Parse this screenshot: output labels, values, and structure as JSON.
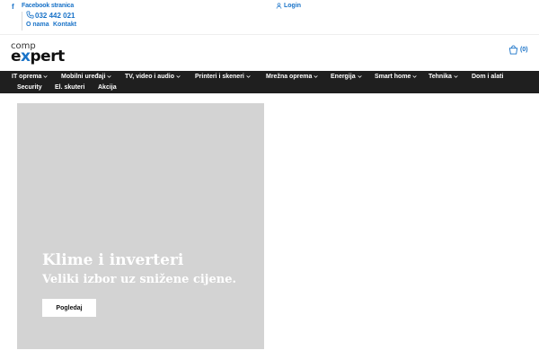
{
  "topbar": {
    "facebook_icon": "facebook-icon",
    "facebook_text": "Facebook stranica",
    "phone_icon": "phone-icon",
    "phone": "032 442 021",
    "about_label": "O nama",
    "contact_label": "Kontakt",
    "login_icon": "user-icon",
    "login_label": "Login"
  },
  "logo": {
    "line1": "comp",
    "line2_part1": "e",
    "line2_part2": "x",
    "line2_part3": "pert"
  },
  "cart": {
    "icon": "shopping-bag-icon",
    "count": "(0)"
  },
  "nav": {
    "items": [
      {
        "label": "IT oprema"
      },
      {
        "label": "Mobilni uređaji"
      },
      {
        "label": "TV, video i audio"
      },
      {
        "label": "Printeri i skeneri"
      },
      {
        "label": "Mrežna oprema"
      },
      {
        "label": "Energija"
      },
      {
        "label": "Smart home"
      },
      {
        "label": "Tehnika"
      },
      {
        "label": "Dom i alati"
      },
      {
        "label": "Security"
      },
      {
        "label": "El. skuteri"
      },
      {
        "label": "Akcija"
      }
    ]
  },
  "hero": {
    "title": "Klime i inverteri",
    "subtitle": "Veliki izbor uz snižene cijene.",
    "button_label": "Pogledaj"
  },
  "colors": {
    "accent": "#1a73c8",
    "nav_bg": "#1f1f1f",
    "hero_bg": "#d3d3d3"
  }
}
